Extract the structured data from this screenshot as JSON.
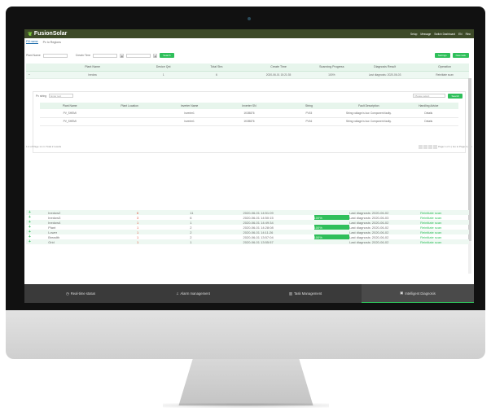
{
  "app": {
    "title": "FusionSolar"
  },
  "header": {
    "links": [
      "Setup",
      "Message",
      "Switch Dashboard",
      "EN",
      "Rinx"
    ]
  },
  "tabs": [
    "Fill name",
    "Pv Io Regions"
  ],
  "filter": {
    "name_label": "Plant Name",
    "date_label": "Creatn Time",
    "search_label": "Search",
    "btn_settings": "Settings",
    "btn_new": "New task"
  },
  "main_table": {
    "columns": [
      "Plant Name",
      "Device Qnt",
      "Total Strs",
      "Create Time",
      "Scanning Progress",
      "Diagnosis Result",
      "Operation"
    ],
    "rows": [
      {
        "name": "Inedow",
        "device": "1",
        "strs": "6",
        "time": "2020-06-01 15:21:35",
        "progress": "100%",
        "result": "Last diagnosis: 2020-06-03",
        "op": "Reinitiate scan"
      }
    ]
  },
  "sub": {
    "field_label": "Pv string",
    "field_placeholder": "Enter text",
    "right_placeholder": "Please select",
    "btn_search": "Search",
    "columns": [
      "Plant Name",
      "Plant Location",
      "Inverter Name",
      "Inverter SN",
      "String",
      "Fault Description",
      "Handling Advice"
    ],
    "rows": [
      {
        "plant": "PV_SHEMI",
        "loc": "",
        "inv": "Inverter1",
        "sn": "1K3B876",
        "str": "PV15",
        "fault": "String voltage is low. Component faulty.",
        "adv": "Details"
      },
      {
        "plant": "PV_SHEMI",
        "loc": "",
        "inv": "Inverter1",
        "sn": "1K3B876",
        "str": "PV16",
        "fault": "String voltage is low. Component faulty.",
        "adv": "Details"
      }
    ],
    "pager_left": "1-2 of Page 1-1 in Total 2 results",
    "pager_right": "Page 1 of 1 | Go to Page 1 | Go"
  },
  "lower_table": {
    "rows": [
      {
        "name": "Inedow2",
        "device": "6",
        "strs": "11",
        "time": "2020-06-01 14:51:09",
        "progress": "100%",
        "result": "Last diagnosis: 2020-06-02",
        "op": "Reinitiate scan"
      },
      {
        "name": "Inedow3",
        "device": "3",
        "strs": "6",
        "time": "2020-06-01 14:50:15",
        "progress": "100%",
        "result": "Last diagnosis: 2020-06-03",
        "op": "Reinitiate scan"
      },
      {
        "name": "Inedow4",
        "device": "1",
        "strs": "1",
        "time": "2020-06-01 14:49:34",
        "progress": "100%",
        "result": "Last diagnosis: 2020-06-02",
        "op": "Reinitiate scan"
      },
      {
        "name": "Plant",
        "device": "1",
        "strs": "2",
        "time": "2020-06-01 14:28:08",
        "progress": "100%",
        "result": "Last diagnosis: 2020-06-02",
        "op": "Reinitiate scan"
      },
      {
        "name": "Lower",
        "device": "1",
        "strs": "2",
        "time": "2020-06-01 14:11:26",
        "progress": "100%",
        "result": "Last diagnosis: 2020-06-02",
        "op": "Reinitiate scan"
      },
      {
        "name": "Breadth",
        "device": "1",
        "strs": "2",
        "time": "2020-06-01 13:57:04",
        "progress": "100%",
        "result": "Last diagnosis: 2020-06-02",
        "op": "Reinitiate scan"
      },
      {
        "name": "Grid",
        "device": "1",
        "strs": "1",
        "time": "2020-06-01 13:55:57",
        "progress": "100%",
        "result": "Last diagnosis: 2020-06-02",
        "op": "Reinitiate scan"
      }
    ]
  },
  "bottom_nav": [
    {
      "label": "Real-time status",
      "icon": "clock-icon",
      "glyph": "◷"
    },
    {
      "label": "Alarm management",
      "icon": "bell-icon",
      "glyph": "♫"
    },
    {
      "label": "Task Management",
      "icon": "chart-icon",
      "glyph": "▥"
    },
    {
      "label": "Intelligent Diagnosis",
      "icon": "diagnosis-icon",
      "glyph": "▣"
    }
  ],
  "colors": {
    "accent": "#2fbf5a",
    "topbar": "#3d4a28",
    "navbar": "#3a3a3a"
  }
}
